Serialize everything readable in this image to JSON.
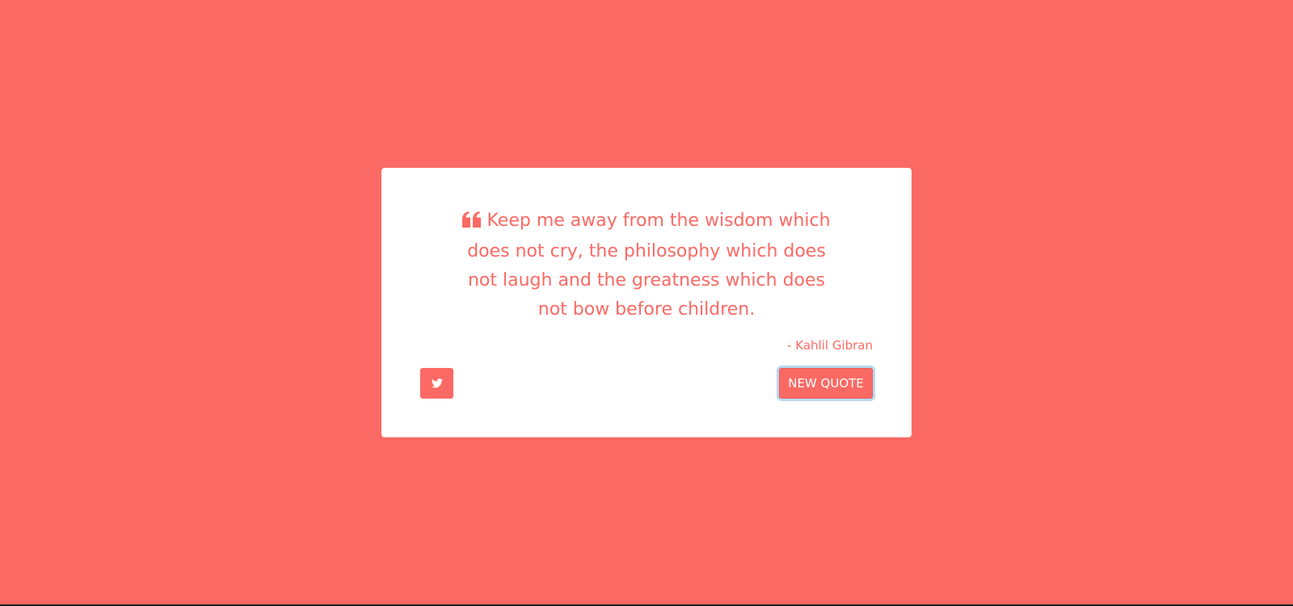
{
  "quote": {
    "text": "Keep me away from the wisdom which does not cry, the philosophy which does not laugh and the greatness which does not bow before children.",
    "author": "- Kahlil Gibran",
    "icon": "quote-left-icon"
  },
  "actions": {
    "tweet_icon": "twitter-icon",
    "new_quote_label": "NEW QUOTE"
  },
  "colors": {
    "background": "#fb6964",
    "card": "#ffffff",
    "accent": "#fb6964",
    "focus_ring": "#b9d7ef"
  }
}
